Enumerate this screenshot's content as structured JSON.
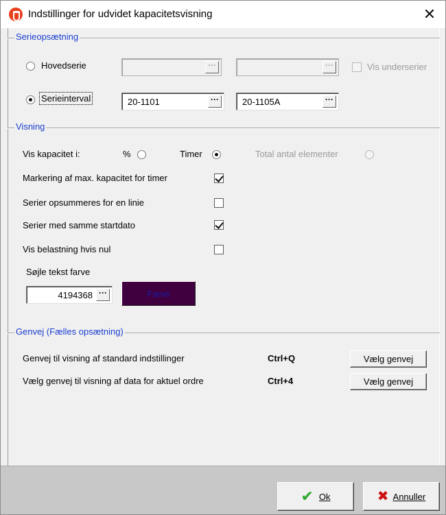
{
  "window": {
    "title": "Indstillinger for udvidet kapacitetsvisning",
    "close_glyph": "✕"
  },
  "serie": {
    "legend": "Serieopsætning",
    "hovedserie_label": "Hovedserie",
    "hovedserie_from": "",
    "hovedserie_to": "",
    "vis_underserier_label": "Vis underserier",
    "serieinterval_label": "Serieinterval",
    "interval_from": "20-1101",
    "interval_to": "20-1105A",
    "dots": "···"
  },
  "visning": {
    "legend": "Visning",
    "vis_kapacitet_label": "Vis kapacitet i:",
    "percent_label": "%",
    "timer_label": "Timer",
    "total_label": "Total antal elementer",
    "option_markering": "Markering af max. kapacitet for timer",
    "option_opsummeres": "Serier opsummeres for en linie",
    "option_startdato": "Serier med samme startdato",
    "option_nul": "Vis belastning hvis nul",
    "farve_label": "Søjle tekst farve",
    "farve_value": "4194368",
    "farve_button": "Farve",
    "farve_color": "#400040"
  },
  "genvej": {
    "legend": "Genvej (Fælles opsætning)",
    "row1_label": "Genvej til visning af standard indstillinger",
    "row1_shortcut": "Ctrl+Q",
    "row2_label": "Vælg genvej til visning af data for aktuel ordre",
    "row2_shortcut": "Ctrl+4",
    "button_label": "Vælg genvej"
  },
  "footer": {
    "ok_label": "Ok",
    "cancel_label": "Annuller"
  }
}
